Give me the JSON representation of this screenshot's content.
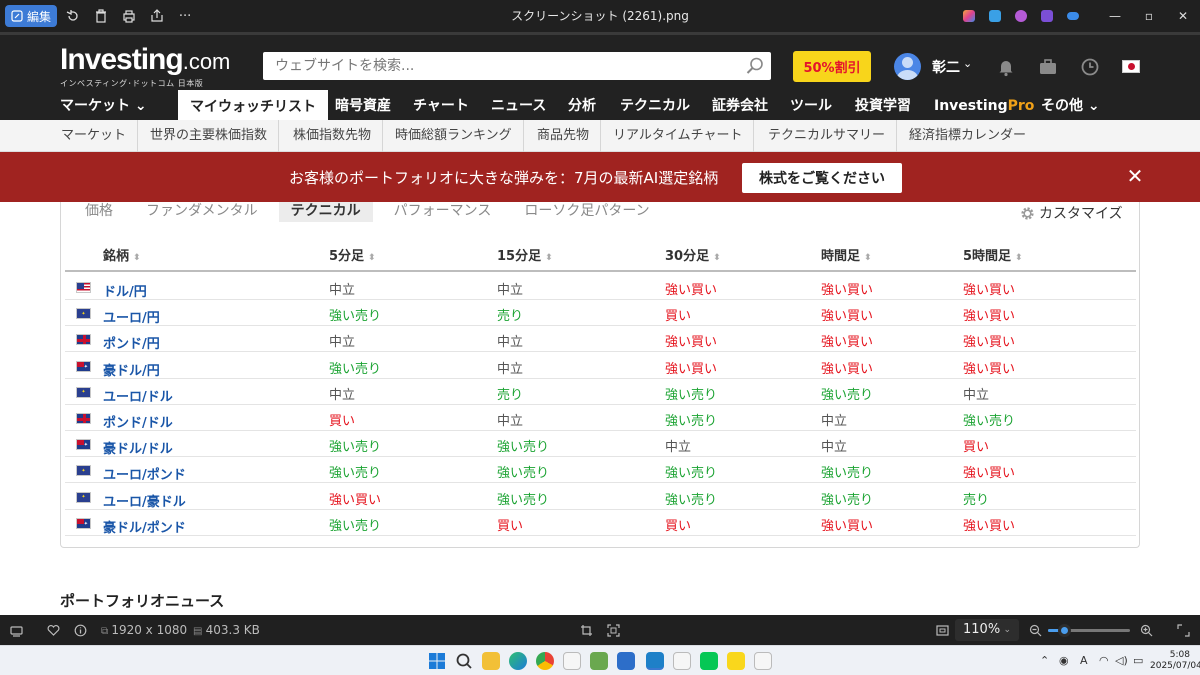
{
  "app_window": {
    "edit_label": "編集",
    "title": "スクリーンショット (2261).png"
  },
  "site": {
    "logo_main": "Investing",
    "logo_suffix": ".com",
    "logo_sub": "インベスティング･ドットコム 日本版",
    "search_placeholder": "ウェブサイトを検索...",
    "promo_label": "50%割引",
    "user_name": "彰二",
    "main_nav": [
      {
        "label": "マーケット ⌄"
      },
      {
        "label": "マイウォッチリスト"
      },
      {
        "label": "暗号資産"
      },
      {
        "label": "チャート"
      },
      {
        "label": "ニュース"
      },
      {
        "label": "分析"
      },
      {
        "label": "テクニカル"
      },
      {
        "label": "証券会社"
      },
      {
        "label": "ツール"
      },
      {
        "label": "投資学習"
      },
      {
        "label": "Investing",
        "suffix": "Pro"
      },
      {
        "label": "その他 ⌄"
      }
    ],
    "sub_nav": [
      "マーケット",
      "世界の主要株価指数",
      "株価指数先物",
      "時価総額ランキング",
      "商品先物",
      "リアルタイムチャート",
      "テクニカルサマリー",
      "経済指標カレンダー"
    ]
  },
  "banner": {
    "text": "お客様のポートフォリオに大きな弾みを：7月の最新AI選定銘柄",
    "button": "株式をご覧ください",
    "close": "✕"
  },
  "watchlist": {
    "tabs": [
      "価格",
      "ファンダメンタル",
      "テクニカル",
      "パフォーマンス",
      "ローソク足パターン"
    ],
    "active_tab": "テクニカル",
    "customize_label": "カスタマイズ",
    "columns": [
      "銘柄",
      "5分足",
      "15分足",
      "30分足",
      "時間足",
      "5時間足"
    ],
    "rows": [
      {
        "flag": "us",
        "pair": "ドル/円",
        "signals": [
          "中立",
          "中立",
          "強い買い",
          "強い買い",
          "強い買い"
        ]
      },
      {
        "flag": "eu",
        "pair": "ユーロ/円",
        "signals": [
          "強い売り",
          "売り",
          "買い",
          "強い買い",
          "強い買い"
        ]
      },
      {
        "flag": "gb",
        "pair": "ポンド/円",
        "signals": [
          "中立",
          "中立",
          "強い買い",
          "強い買い",
          "強い買い"
        ]
      },
      {
        "flag": "au",
        "pair": "豪ドル/円",
        "signals": [
          "強い売り",
          "中立",
          "強い買い",
          "強い買い",
          "強い買い"
        ]
      },
      {
        "flag": "eu",
        "pair": "ユーロ/ドル",
        "signals": [
          "中立",
          "売り",
          "強い売り",
          "強い売り",
          "中立"
        ]
      },
      {
        "flag": "gb",
        "pair": "ポンド/ドル",
        "signals": [
          "買い",
          "中立",
          "強い売り",
          "中立",
          "強い売り"
        ]
      },
      {
        "flag": "au",
        "pair": "豪ドル/ドル",
        "signals": [
          "強い売り",
          "強い売り",
          "中立",
          "中立",
          "買い"
        ]
      },
      {
        "flag": "eu",
        "pair": "ユーロ/ポンド",
        "signals": [
          "強い売り",
          "強い売り",
          "強い売り",
          "強い売り",
          "強い買い"
        ]
      },
      {
        "flag": "eu",
        "pair": "ユーロ/豪ドル",
        "signals": [
          "強い買い",
          "強い売り",
          "強い売り",
          "強い売り",
          "売り"
        ]
      },
      {
        "flag": "au",
        "pair": "豪ドル/ポンド",
        "signals": [
          "強い売り",
          "買い",
          "買い",
          "強い買い",
          "強い買い"
        ]
      }
    ]
  },
  "portfolio_news_title": "ポートフォリオニュース",
  "statusbar": {
    "dimensions": "1920 x 1080",
    "file_size": "403.3 KB",
    "zoom": "110%",
    "zoom_slider_fraction": 0.2
  },
  "taskbar": {
    "time": "5:08",
    "date": "2025/07/04",
    "ime": "A"
  },
  "colors": {
    "buy": "#e5131d",
    "sell": "#1ba332",
    "neutral": "#555555",
    "banner": "#a02320",
    "promo": "#f8d51b",
    "header": "#222222"
  }
}
